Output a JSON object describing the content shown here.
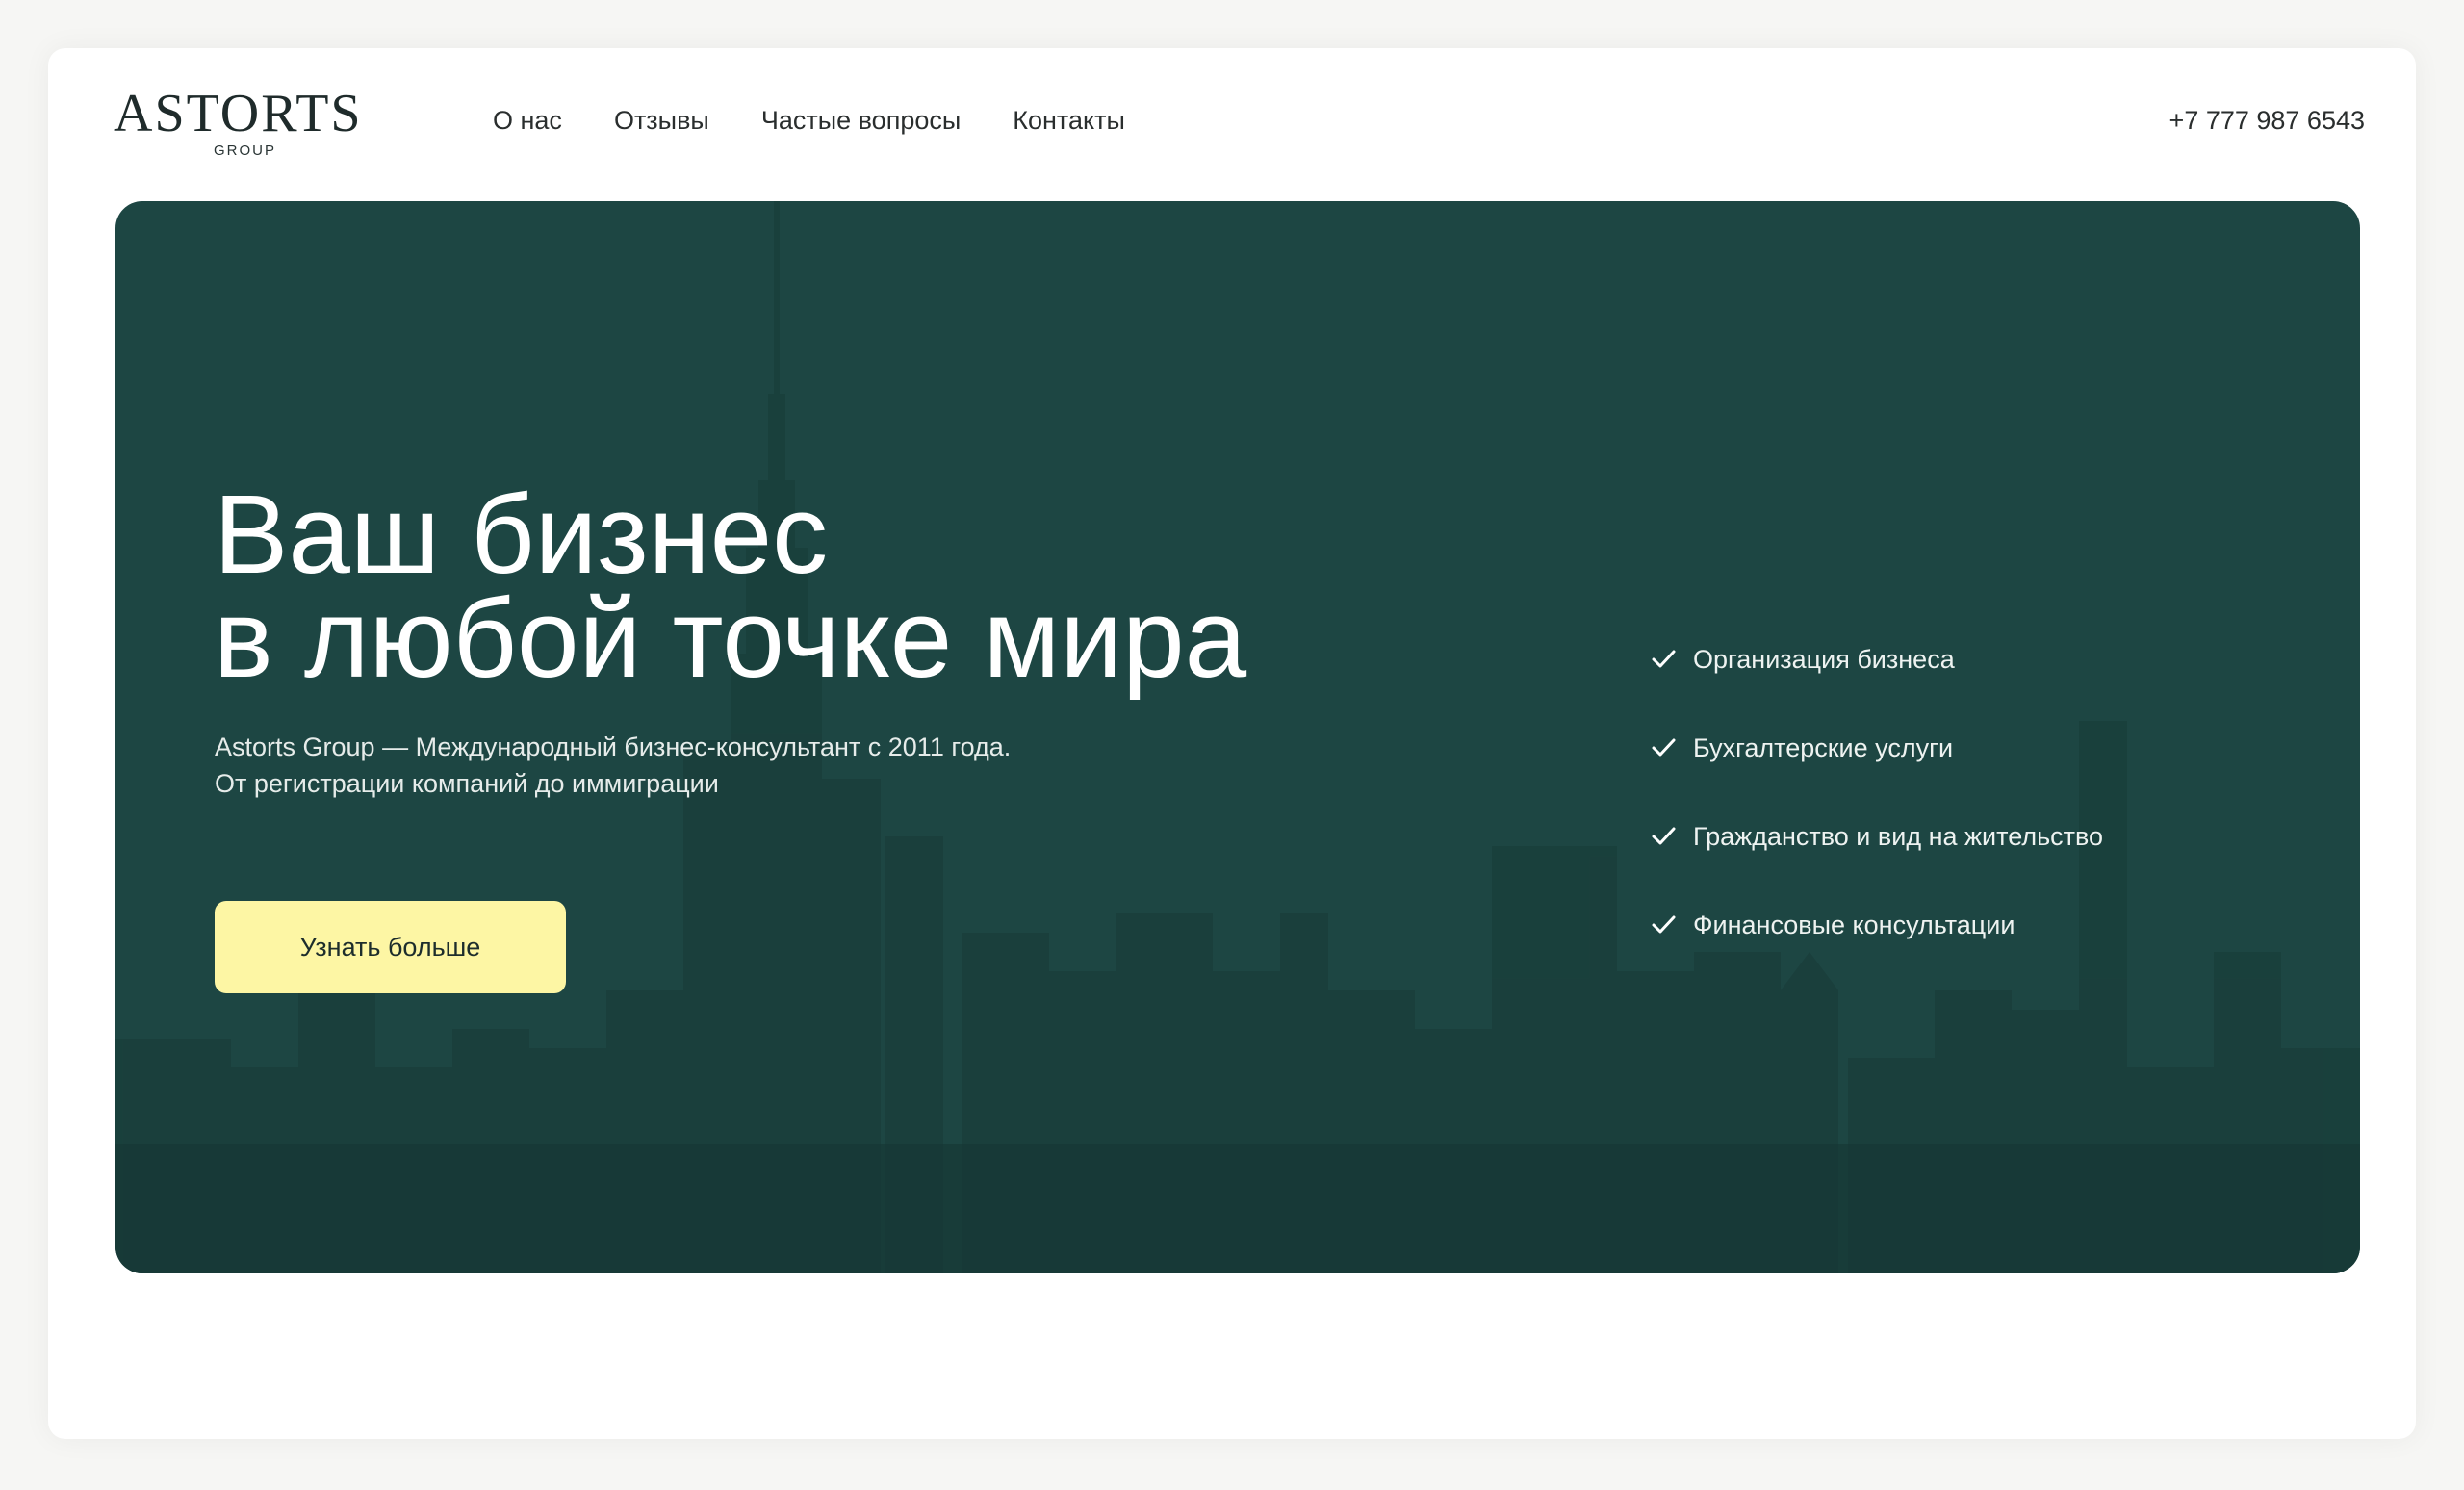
{
  "header": {
    "logo_text": "ASTORTS",
    "logo_subtext": "GROUP",
    "nav": [
      "О нас",
      "Отзывы",
      "Частые вопросы",
      "Контакты"
    ],
    "phone": "+7 777 987 6543"
  },
  "hero": {
    "title_line1": "Ваш бизнес",
    "title_line2": "в любой точке мира",
    "subtitle_line1": "Astorts Group — Международный бизнес-консультант с 2011 года.",
    "subtitle_line2": "От регистрации компаний до иммиграции",
    "cta_label": "Узнать больше",
    "services": [
      "Организация бизнеса",
      "Бухгалтерские услуги",
      "Гражданство и вид на жительство",
      "Финансовые консультации"
    ]
  },
  "colors": {
    "hero_background": "#1d4643",
    "cta_background": "#fdf6a4",
    "text_dark": "#2a2e2e"
  },
  "icons": {
    "service_bullet": "check-icon",
    "hero_background_image": "city-skyline"
  }
}
